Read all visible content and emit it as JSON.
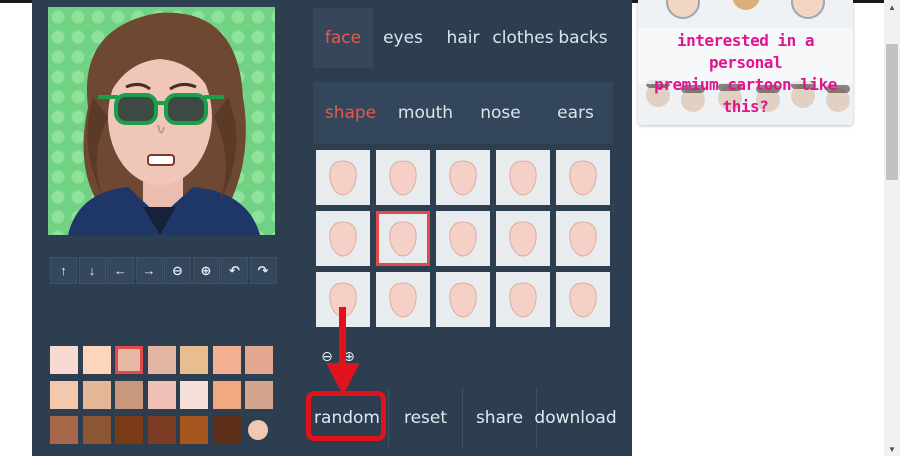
{
  "tabs": {
    "main": [
      {
        "label": "face",
        "active": true
      },
      {
        "label": "eyes",
        "active": false
      },
      {
        "label": "hair",
        "active": false
      },
      {
        "label": "clothes",
        "active": false
      },
      {
        "label": "backs",
        "active": false
      }
    ],
    "sub": [
      {
        "label": "shape",
        "active": true
      },
      {
        "label": "mouth",
        "active": false
      },
      {
        "label": "nose",
        "active": false
      },
      {
        "label": "ears",
        "active": false
      }
    ]
  },
  "avatar_toolbar": {
    "buttons": [
      {
        "icon": "arrow-up-icon",
        "glyph": "↑"
      },
      {
        "icon": "arrow-down-icon",
        "glyph": "↓"
      },
      {
        "icon": "arrow-left-icon",
        "glyph": "←"
      },
      {
        "icon": "arrow-right-icon",
        "glyph": "→"
      },
      {
        "icon": "zoom-out-icon",
        "glyph": "⊖"
      },
      {
        "icon": "zoom-in-icon",
        "glyph": "⊕"
      },
      {
        "icon": "undo-icon",
        "glyph": "↶"
      },
      {
        "icon": "redo-icon",
        "glyph": "↷"
      }
    ]
  },
  "skin_colors": {
    "selected_index": 2,
    "rows": [
      [
        "#f6d9d0",
        "#fdd5bb",
        "#e7b8a3",
        "#e3b6a3",
        "#e8bd90",
        "#f2b190",
        "#e3a88f"
      ],
      [
        "#f3c8ab",
        "#e4b896",
        "#c9977c",
        "#eec0b6",
        "#f5e0da",
        "#f2a982",
        "#d3a58d"
      ],
      [
        "#a8664a",
        "#8b5536",
        "#7a3a16",
        "#7c3d24",
        "#a8561f",
        "#5e301a",
        "#f2c8b2"
      ]
    ]
  },
  "face_shapes": {
    "selected_index": 6,
    "count": 15,
    "skin": "#f5d0c7",
    "outline": "#d9aca0"
  },
  "shape_zoom": [
    {
      "icon": "zoom-out-icon",
      "glyph": "⊖"
    },
    {
      "icon": "zoom-in-icon",
      "glyph": "⊕"
    }
  ],
  "actions": {
    "random": "random",
    "reset": "reset",
    "share": "share",
    "download": "download"
  },
  "ad": {
    "line1": "interested in a personal",
    "line2": "premium cartoon like this?"
  },
  "colors": {
    "panel": "#2e3e51",
    "accent": "#e8584a",
    "highlight": "#e0121b",
    "avatar_bg": "#72d283"
  }
}
